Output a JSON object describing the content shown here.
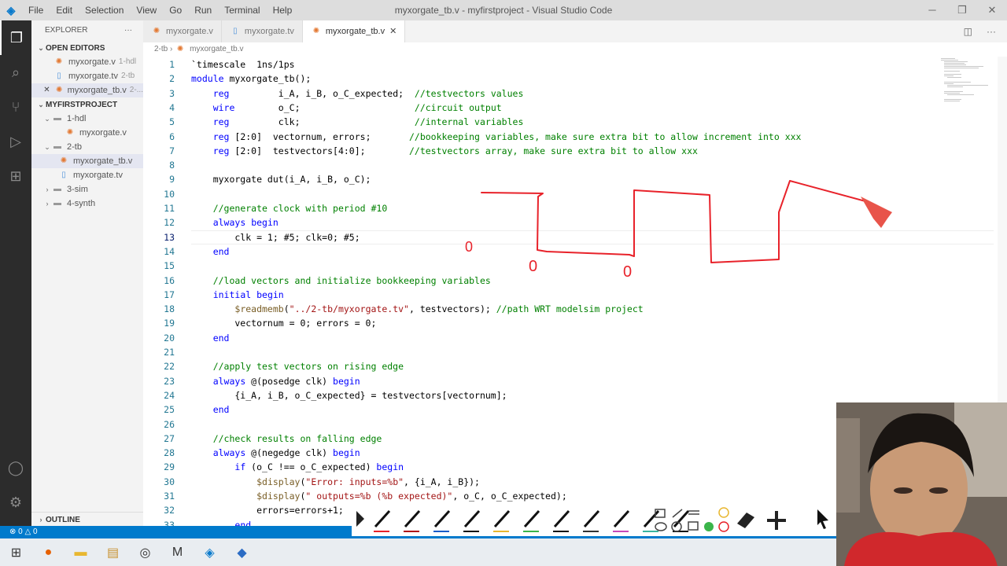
{
  "window": {
    "title": "myxorgate_tb.v - myfirstproject - Visual Studio Code",
    "menu": [
      "File",
      "Edit",
      "Selection",
      "View",
      "Go",
      "Run",
      "Terminal",
      "Help"
    ]
  },
  "sidebar": {
    "header": "EXPLORER",
    "open_editors_label": "OPEN EDITORS",
    "open_editors": [
      {
        "name": "myxorgate.v",
        "sub": "1-hdl",
        "type": "v"
      },
      {
        "name": "myxorgate.tv",
        "sub": "2-tb",
        "type": "tv"
      },
      {
        "name": "myxorgate_tb.v",
        "sub": "2-...",
        "type": "v"
      }
    ],
    "project_label": "MYFIRSTPROJECT",
    "tree": [
      {
        "name": "1-hdl",
        "kind": "folder-open"
      },
      {
        "name": "myxorgate.v",
        "kind": "v"
      },
      {
        "name": "2-tb",
        "kind": "folder-open"
      },
      {
        "name": "myxorgate_tb.v",
        "kind": "v"
      },
      {
        "name": "myxorgate.tv",
        "kind": "tv"
      },
      {
        "name": "3-sim",
        "kind": "folder"
      },
      {
        "name": "4-synth",
        "kind": "folder"
      }
    ],
    "outline_label": "OUTLINE"
  },
  "tabs": [
    {
      "label": "myxorgate.v",
      "type": "v",
      "active": false
    },
    {
      "label": "myxorgate.tv",
      "type": "tv",
      "active": false
    },
    {
      "label": "myxorgate_tb.v",
      "type": "v",
      "active": true
    }
  ],
  "breadcrumb": {
    "folder": "2-tb",
    "file": "myxorgate_tb.v"
  },
  "editor": {
    "current_line": 13,
    "lines": [
      {
        "n": 1,
        "text": "`timescale  1ns/1ps"
      },
      {
        "n": 2,
        "text": "module myxorgate_tb();"
      },
      {
        "n": 3,
        "text": "    reg         i_A, i_B, o_C_expected;  //testvectors values"
      },
      {
        "n": 4,
        "text": "    wire        o_C;                     //circuit output"
      },
      {
        "n": 5,
        "text": "    reg         clk;                     //internal variables"
      },
      {
        "n": 6,
        "text": "    reg [2:0]  vectornum, errors;       //bookkeeping variables, make sure extra bit to allow increment into xxx"
      },
      {
        "n": 7,
        "text": "    reg [2:0]  testvectors[4:0];        //testvectors array, make sure extra bit to allow xxx"
      },
      {
        "n": 8,
        "text": ""
      },
      {
        "n": 9,
        "text": "    myxorgate dut(i_A, i_B, o_C);"
      },
      {
        "n": 10,
        "text": ""
      },
      {
        "n": 11,
        "text": "    //generate clock with period #10"
      },
      {
        "n": 12,
        "text": "    always begin"
      },
      {
        "n": 13,
        "text": "        clk = 1; #5; clk=0; #5;"
      },
      {
        "n": 14,
        "text": "    end"
      },
      {
        "n": 15,
        "text": ""
      },
      {
        "n": 16,
        "text": "    //load vectors and initialize bookkeeping variables"
      },
      {
        "n": 17,
        "text": "    initial begin"
      },
      {
        "n": 18,
        "text": "        $readmemb(\"../2-tb/myxorgate.tv\", testvectors); //path WRT modelsim project"
      },
      {
        "n": 19,
        "text": "        vectornum = 0; errors = 0;"
      },
      {
        "n": 20,
        "text": "    end"
      },
      {
        "n": 21,
        "text": ""
      },
      {
        "n": 22,
        "text": "    //apply test vectors on rising edge"
      },
      {
        "n": 23,
        "text": "    always @(posedge clk) begin"
      },
      {
        "n": 24,
        "text": "        {i_A, i_B, o_C_expected} = testvectors[vectornum];"
      },
      {
        "n": 25,
        "text": "    end"
      },
      {
        "n": 26,
        "text": ""
      },
      {
        "n": 27,
        "text": "    //check results on falling edge"
      },
      {
        "n": 28,
        "text": "    always @(negedge clk) begin"
      },
      {
        "n": 29,
        "text": "        if (o_C !== o_C_expected) begin"
      },
      {
        "n": 30,
        "text": "            $display(\"Error: inputs=%b\", {i_A, i_B});"
      },
      {
        "n": 31,
        "text": "            $display(\" outputs=%b (%b expected)\", o_C, o_C_expected);"
      },
      {
        "n": 32,
        "text": "            errors=errors+1;"
      },
      {
        "n": 33,
        "text": "        end"
      }
    ]
  },
  "status": {
    "errors": "0",
    "warnings": "0"
  },
  "annotations": {
    "stroke_color": "#e8222a",
    "labels": [
      "0",
      "0",
      "0"
    ]
  },
  "colors": {
    "accent": "#007acc",
    "keyword": "#0000ff",
    "comment": "#008000",
    "string": "#a31515"
  }
}
